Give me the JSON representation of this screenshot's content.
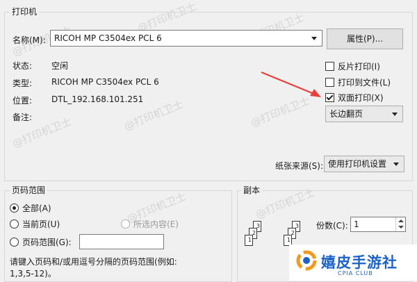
{
  "printer": {
    "legend": "打印机",
    "name_label": "名称(M):",
    "name_value": "RICOH MP C3504ex PCL 6",
    "properties_button": "属性(P)...",
    "status_label": "状态:",
    "status_value": "空闲",
    "type_label": "类型:",
    "type_value": "RICOH MP C3504ex PCL 6",
    "location_label": "位置:",
    "location_value": "DTL_192.168.101.251",
    "comment_label": "备注:",
    "reverse_print": "反片打印(I)",
    "print_to_file": "打印到文件(L)",
    "duplex_print": "双面打印(X)",
    "duplex_mode": "长边翻页",
    "paper_source_label": "纸张来源(S):",
    "paper_source_value": "使用打印机设置"
  },
  "page_range": {
    "legend": "页码范围",
    "all": "全部(A)",
    "current": "当前页(U)",
    "selection": "所选内容(E)",
    "pages": "页码范围(G):",
    "hint_line1": "请键入页码和/或用逗号分隔的页码范围(例如:",
    "hint_line2": "1,3,5-12)。"
  },
  "copies": {
    "legend": "副本",
    "count_label": "份数(C):",
    "count_value": "1",
    "collate_labels_a": [
      "3",
      "2",
      "1"
    ],
    "collate_labels_b": [
      "3",
      "2",
      "1"
    ]
  },
  "watermark": "@打印机卫士",
  "brand": {
    "name": "嬉皮手游社",
    "sub": "CPIA CLUB"
  },
  "colors": {
    "arrow": "#e8413c",
    "brand": "#1a62c8"
  }
}
